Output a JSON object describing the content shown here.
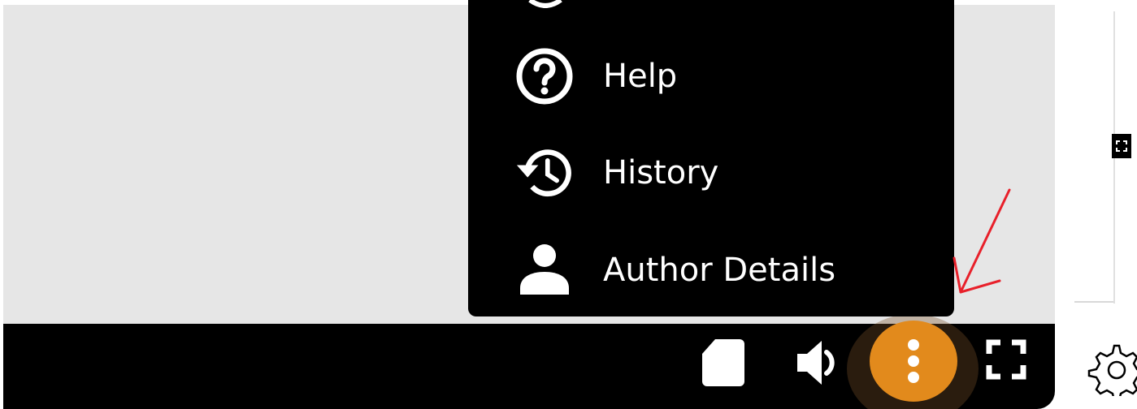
{
  "menu": {
    "items": [
      {
        "label": "Help",
        "icon": "help-circle-icon"
      },
      {
        "label": "History",
        "icon": "history-icon"
      },
      {
        "label": "Author Details",
        "icon": "person-icon"
      }
    ]
  },
  "toolbar": {
    "buttons": [
      {
        "icon": "page-icon"
      },
      {
        "icon": "volume-icon"
      },
      {
        "icon": "more-vertical-icon",
        "active": true
      },
      {
        "icon": "fullscreen-icon"
      }
    ]
  },
  "colors": {
    "canvas": "#e6e6e6",
    "toolbar": "#000000",
    "menu_background": "#000000",
    "accent": "#e28a1c",
    "annotation": "#e8202a"
  }
}
